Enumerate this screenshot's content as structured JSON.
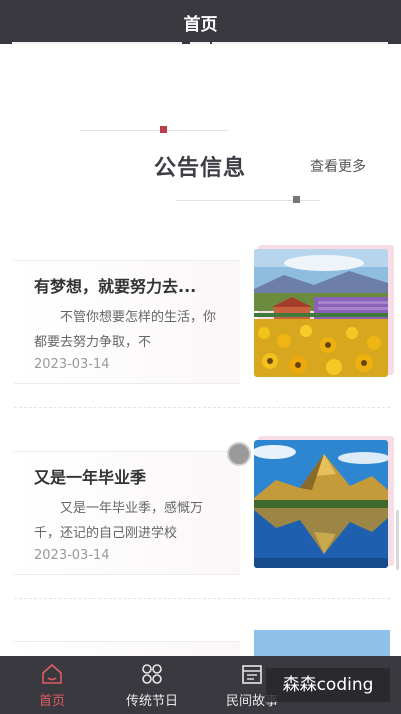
{
  "header": {
    "title": "首页"
  },
  "notice_section": {
    "title": "公告信息",
    "more_label": "查看更多"
  },
  "news": [
    {
      "title": "有梦想，就要努力去...",
      "summary": "不管你想要怎样的生活，你都要去努力争取，不",
      "date": "2023-03-14",
      "image_icon": "sunflower-field-photo"
    },
    {
      "title": "又是一年毕业季",
      "summary": "又是一年毕业季，感慨万千，还记的自己刚进学校",
      "date": "2023-03-14",
      "image_icon": "mountain-lake-photo"
    }
  ],
  "tabbar": {
    "items": [
      {
        "label": "首页",
        "icon": "home-icon",
        "active": true
      },
      {
        "label": "传统节日",
        "icon": "grid-icon",
        "active": false
      },
      {
        "label": "民间故事",
        "icon": "calendar-icon",
        "active": false
      }
    ]
  },
  "watermark": {
    "text": "森森coding"
  },
  "colors": {
    "bar": "#3b3940",
    "accent": "#e15b64",
    "card_accent": "#f7dde5"
  }
}
